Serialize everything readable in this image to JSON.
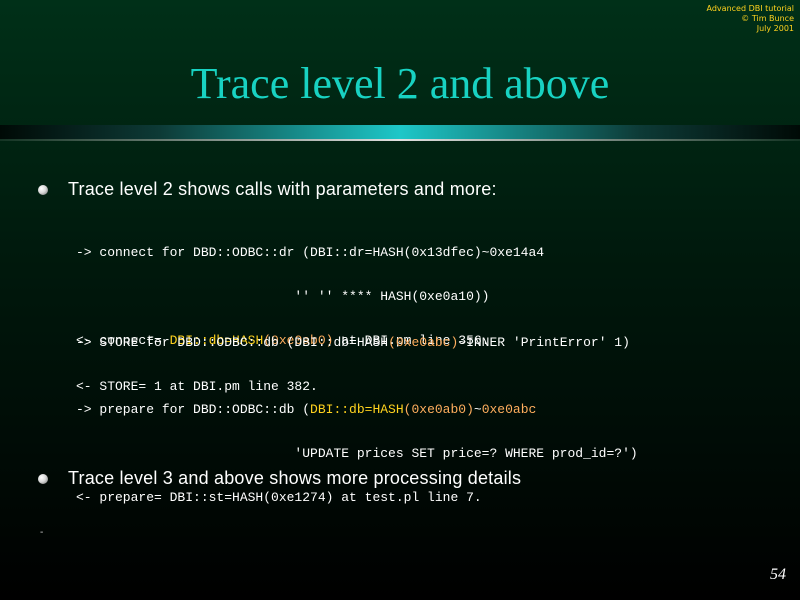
{
  "credit": {
    "line1": "Advanced DBI tutorial",
    "line2": "© Tim Bunce",
    "line3": "July 2001"
  },
  "title": "Trace level 2 and above",
  "bullets": [
    {
      "text": "Trace level 2 shows calls with parameters and more:"
    },
    {
      "text": "Trace level 3 and above shows more processing details"
    }
  ],
  "code": {
    "block1": {
      "l1": "-> connect for DBD::ODBC::dr (DBI::dr=HASH(0x13dfec)~0xe14a4",
      "l2": "                            '' '' **** HASH(0xe0a10))",
      "l3_a": "<- connect= ",
      "l3_b": "DBI::db=HASH",
      "l3_c": "(0xe0ab0)",
      "l3_d": " at DBI.pm line 356."
    },
    "block2": {
      "l1_a": "-> STORE for DBD::ODBC::db (DBI::db=HASH",
      "l1_b": "(0xe0abc)",
      "l1_c": "~INNER 'PrintError' 1)",
      "l2": "<- STORE= 1 at DBI.pm line 382."
    },
    "block3": {
      "l1_a": "-> prepare for DBD::ODBC::db (",
      "l1_b": "DBI::db=HASH",
      "l1_c": "(0xe0ab0)",
      "l1_d": "~",
      "l1_e": "0xe0abc",
      "l2": "                            'UPDATE prices SET price=? WHERE prod_id=?')",
      "l3": "<- prepare= DBI::st=HASH(0xe1274) at test.pl line 7."
    }
  },
  "dash": "-",
  "page_number": "54",
  "colors": {
    "title": "#18d2c2",
    "highlight_yellow": "#ffd21e",
    "highlight_orange": "#ffae5e",
    "background_top": "#003018"
  }
}
